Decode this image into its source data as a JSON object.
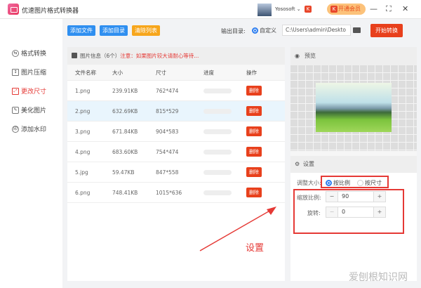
{
  "app": {
    "title": "优速图片格式转换器",
    "user": "Yososoft ⌄",
    "vip": "开通会员",
    "minimize": "—",
    "maximize": "⛶",
    "close": "✕"
  },
  "sidebar": {
    "items": [
      {
        "label": "格式转换",
        "icon": "swap-icon"
      },
      {
        "label": "图片压缩",
        "icon": "compress-icon"
      },
      {
        "label": "更改尺寸",
        "icon": "resize-icon",
        "active": true
      },
      {
        "label": "美化图片",
        "icon": "beautify-icon"
      },
      {
        "label": "添加水印",
        "icon": "watermark-icon"
      }
    ]
  },
  "toolbar": {
    "add_file": "添加文件",
    "add_folder": "添加目录",
    "clear_list": "清除列表",
    "output_label": "输出目录:",
    "custom": "自定义",
    "path": "C:\\Users\\admin\\Deskto",
    "start": "开始转换"
  },
  "list": {
    "title": "图片信息（6个）",
    "warning": "注意：如果图片较大请耐心等待...",
    "columns": [
      "文件名称",
      "大小",
      "尺寸",
      "进度",
      "操作"
    ],
    "delete_label": "删除",
    "rows": [
      {
        "name": "1.png",
        "size": "239.91KB",
        "dim": "762*474"
      },
      {
        "name": "2.png",
        "size": "632.69KB",
        "dim": "815*529"
      },
      {
        "name": "3.png",
        "size": "671.84KB",
        "dim": "904*583"
      },
      {
        "name": "4.png",
        "size": "683.60KB",
        "dim": "754*474"
      },
      {
        "name": "5.jpg",
        "size": "59.47KB",
        "dim": "847*558"
      },
      {
        "name": "6.png",
        "size": "748.41KB",
        "dim": "1015*636"
      }
    ]
  },
  "preview": {
    "title": "预览"
  },
  "settings": {
    "title": "设置",
    "resize_label": "调整大小:",
    "opt_ratio": "按比例",
    "opt_size": "按尺寸",
    "scale_label": "缩放比例:",
    "scale_value": "90",
    "rotate_label": "旋转:",
    "rotate_value": "0",
    "minus": "−",
    "plus": "+"
  },
  "annotation": "设置",
  "watermark": "爱刨根知识网",
  "colors": {
    "accent": "#2f7ff0",
    "danger": "#e8401c",
    "warning": "#f5a623"
  }
}
